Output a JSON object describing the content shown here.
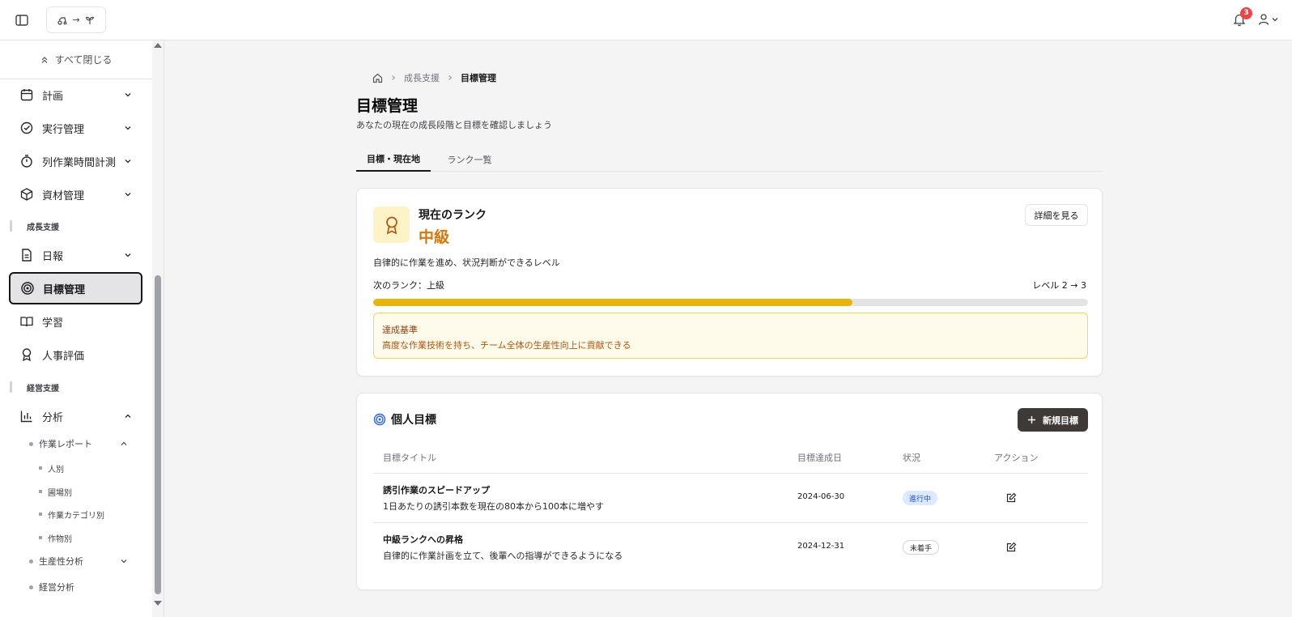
{
  "header": {
    "logo_text": "→",
    "notification_count": "3"
  },
  "sidebar": {
    "collapse_all_label": "すべて閉じる",
    "items": [
      {
        "label": "計画",
        "icon": "calendar-icon"
      },
      {
        "label": "実行管理",
        "icon": "check-circle-icon"
      },
      {
        "label": "列作業時間計測",
        "icon": "timer-icon"
      },
      {
        "label": "資材管理",
        "icon": "package-icon"
      }
    ],
    "section_growth": "成長支援",
    "growth_items": [
      {
        "label": "日報",
        "icon": "document-icon"
      },
      {
        "label": "目標管理",
        "icon": "target-icon"
      },
      {
        "label": "学習",
        "icon": "book-icon"
      },
      {
        "label": "人事評価",
        "icon": "award-icon"
      }
    ],
    "section_management": "経営支援",
    "analysis_label": "分析",
    "work_report_label": "作業レポート",
    "report_subitems": [
      "人別",
      "圃場別",
      "作業カテゴリ別",
      "作物別"
    ],
    "productivity_label": "生産性分析",
    "management_analysis_label": "経営分析"
  },
  "breadcrumb": {
    "parent": "成長支援",
    "current": "目標管理"
  },
  "page": {
    "title": "目標管理",
    "subtitle": "あなたの現在の成長段階と目標を確認しましょう"
  },
  "tabs": [
    {
      "label": "目標・現在地",
      "active": true
    },
    {
      "label": "ランク一覧",
      "active": false
    }
  ],
  "rank": {
    "heading": "現在のランク",
    "value": "中級",
    "detail_button": "詳細を見る",
    "description": "自律的に作業を進め、状況判断ができるレベル",
    "next_rank": "次のランク：上級",
    "level_text": "レベル 2 → 3",
    "progress": 0.67,
    "criteria_title": "達成基準",
    "criteria_text": "高度な作業技術を持ち、チーム全体の生産性向上に貢献できる",
    "accent_color": "#d97706"
  },
  "goals": {
    "heading": "個人目標",
    "new_button": "新規目標",
    "columns": [
      "目標タイトル",
      "目標達成日",
      "状況",
      "アクション"
    ],
    "rows": [
      {
        "title": "誘引作業のスピードアップ",
        "description": "1日あたりの誘引本数を現在の80本から100本に増やす",
        "date": "2024-06-30",
        "status": "進行中",
        "status_type": "progress"
      },
      {
        "title": "中級ランクへの昇格",
        "description": "自律的に作業計画を立て、後輩への指導ができるようになる",
        "date": "2024-12-31",
        "status": "未着手",
        "status_type": "todo"
      }
    ]
  }
}
